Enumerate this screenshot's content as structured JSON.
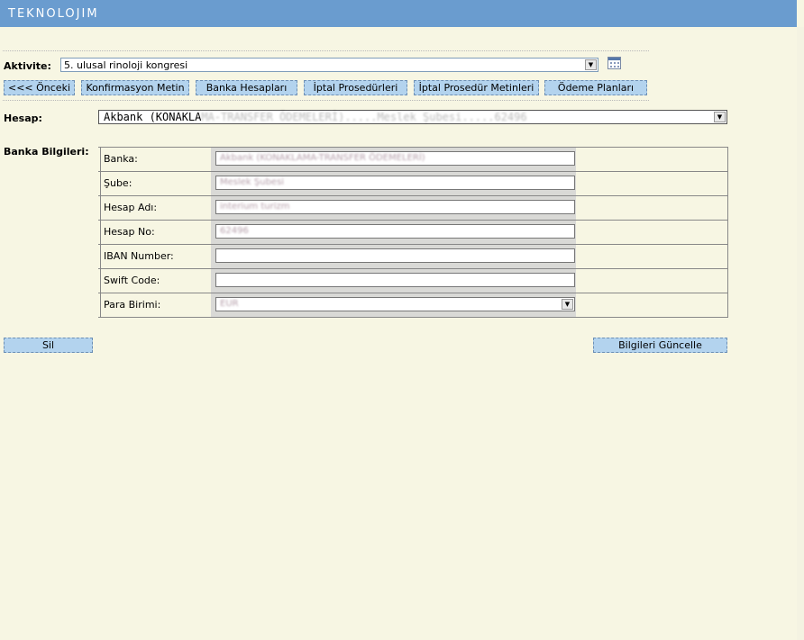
{
  "app": {
    "logo": "TEKNOLOJIM"
  },
  "activity": {
    "label": "Aktivite:",
    "value": "5. ulusal rinoloji kongresi"
  },
  "nav_buttons": [
    "<<< Önceki",
    "Konfirmasyon Metin",
    "Banka Hesapları",
    "İptal Prosedürleri",
    "İptal Prosedür Metinleri",
    "Ödeme Planları"
  ],
  "account": {
    "label": "Hesap:",
    "value_prefix": "Akbank (KONAKLA",
    "value_blurred": "MA-TRANSFER ÖDEMELERİ).....Meslek Şubesi.....62496"
  },
  "bank_info": {
    "label": "Banka Bilgileri:",
    "rows": [
      {
        "label": "Banka:",
        "value": "Akbank (KONAKLAMA-TRANSFER ÖDEMELERİ)"
      },
      {
        "label": "Şube:",
        "value": "Meslek Şubesi"
      },
      {
        "label": "Hesap Adı:",
        "value": "interium turizm"
      },
      {
        "label": "Hesap No:",
        "value": "62496"
      },
      {
        "label": "IBAN Number:",
        "value": ""
      },
      {
        "label": "Swift Code:",
        "value": ""
      },
      {
        "label": "Para Birimi:",
        "value": "EUR"
      }
    ]
  },
  "actions": {
    "delete": "Sil",
    "update": "Bilgileri Güncelle"
  },
  "colors": {
    "header": "#6a9ccf",
    "background": "#f7f6e3",
    "button": "#b3d3ee"
  }
}
